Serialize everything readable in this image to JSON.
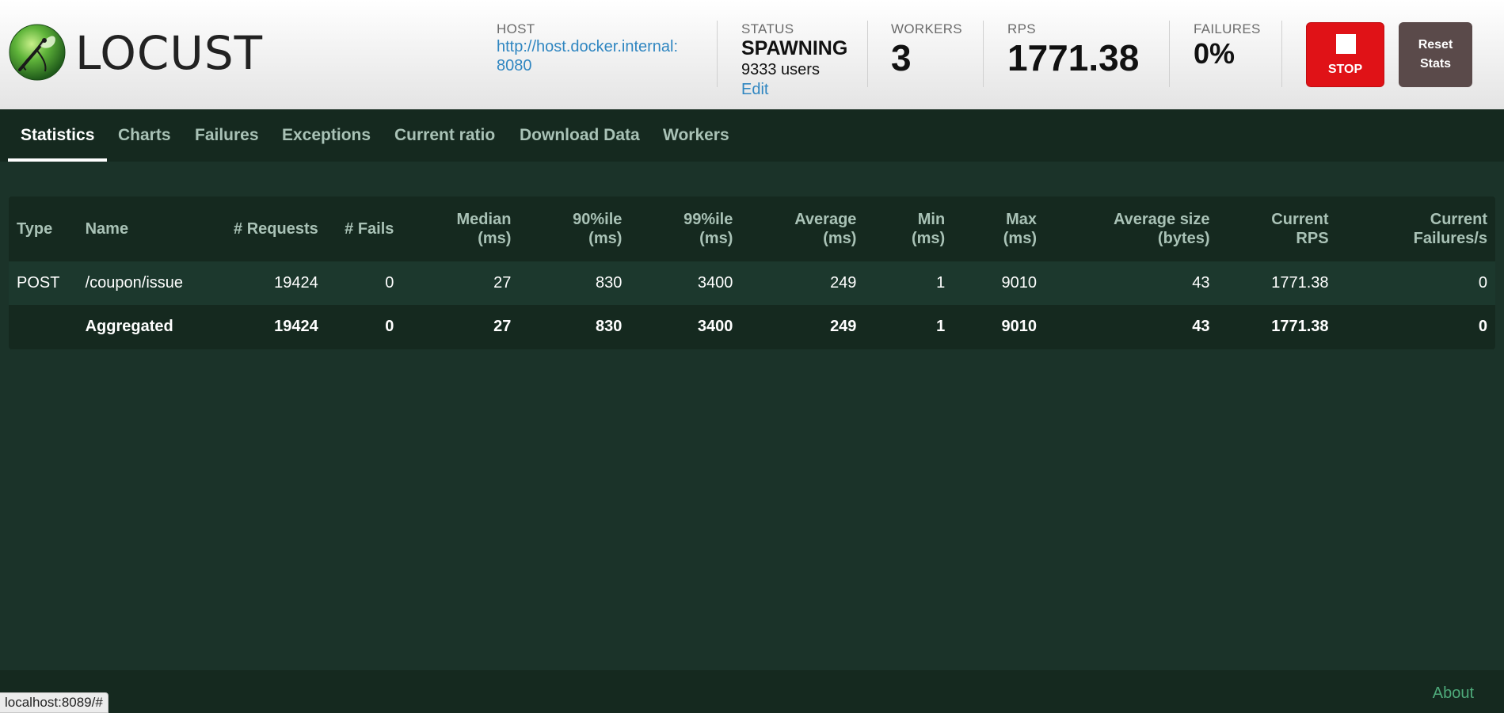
{
  "header": {
    "logo_text": "LOCUST",
    "host": {
      "label": "HOST",
      "value_line1": "http://host.docker.internal:",
      "value_line2": "8080"
    },
    "status": {
      "label": "STATUS",
      "value": "SPAWNING",
      "users": "9333 users",
      "edit": "Edit"
    },
    "workers": {
      "label": "WORKERS",
      "value": "3"
    },
    "rps": {
      "label": "RPS",
      "value": "1771.38"
    },
    "failures": {
      "label": "FAILURES",
      "value": "0%"
    },
    "stop_label": "STOP",
    "reset_label_line1": "Reset",
    "reset_label_line2": "Stats",
    "colors": {
      "stop": "#e01217",
      "reset": "#5a4a4a",
      "link": "#2f86c1"
    }
  },
  "tabs": [
    {
      "label": "Statistics",
      "active": true
    },
    {
      "label": "Charts"
    },
    {
      "label": "Failures"
    },
    {
      "label": "Exceptions"
    },
    {
      "label": "Current ratio"
    },
    {
      "label": "Download Data"
    },
    {
      "label": "Workers"
    }
  ],
  "table": {
    "headers": [
      [
        "Type"
      ],
      [
        "Name"
      ],
      [
        "# Requests"
      ],
      [
        "# Fails"
      ],
      [
        "Median",
        "(ms)"
      ],
      [
        "90%ile",
        "(ms)"
      ],
      [
        "99%ile",
        "(ms)"
      ],
      [
        "Average",
        "(ms)"
      ],
      [
        "Min",
        "(ms)"
      ],
      [
        "Max",
        "(ms)"
      ],
      [
        "Average size",
        "(bytes)"
      ],
      [
        "Current",
        "RPS"
      ],
      [
        "Current",
        "Failures/s"
      ]
    ],
    "rows": [
      [
        "POST",
        "/coupon/issue",
        "19424",
        "0",
        "27",
        "830",
        "3400",
        "249",
        "1",
        "9010",
        "43",
        "1771.38",
        "0"
      ]
    ],
    "aggregated": [
      "",
      "Aggregated",
      "19424",
      "0",
      "27",
      "830",
      "3400",
      "249",
      "1",
      "9010",
      "43",
      "1771.38",
      "0"
    ]
  },
  "footer": {
    "about": "About"
  },
  "statusbar": {
    "url": "localhost:8089/#"
  }
}
